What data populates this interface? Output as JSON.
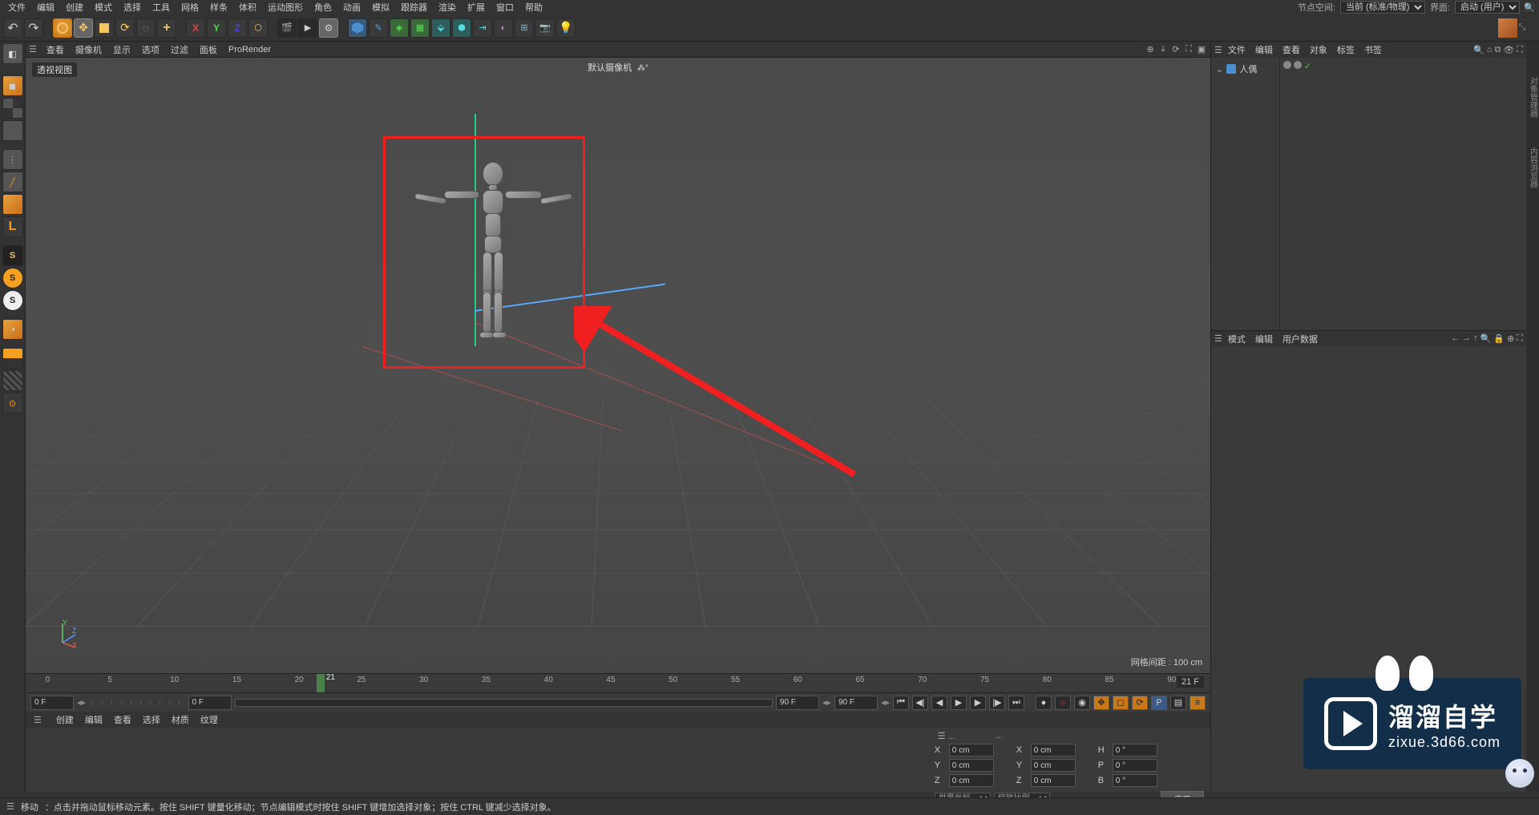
{
  "menubar": {
    "items": [
      "文件",
      "编辑",
      "创建",
      "模式",
      "选择",
      "工具",
      "网格",
      "样条",
      "体积",
      "运动图形",
      "角色",
      "动画",
      "模拟",
      "跟踪器",
      "渲染",
      "扩展",
      "窗口",
      "帮助"
    ],
    "node_space_label": "节点空间:",
    "node_space_value": "当前 (标准/物理)",
    "interface_label": "界面:",
    "interface_value": "启动 (用户)"
  },
  "view_menu": {
    "items": [
      "查看",
      "摄像机",
      "显示",
      "选项",
      "过滤",
      "面板",
      "ProRender"
    ]
  },
  "viewport": {
    "name": "透视视图",
    "camera": "默认摄像机",
    "grid_info": "网格间距 : 100 cm"
  },
  "nav_axes": {
    "x": "X",
    "y": "Y",
    "z": "Z"
  },
  "timeline": {
    "ticks": [
      "0",
      "5",
      "10",
      "15",
      "20",
      "25",
      "30",
      "35",
      "40",
      "45",
      "50",
      "55",
      "60",
      "65",
      "70",
      "75",
      "80",
      "85",
      "90"
    ],
    "playhead_frame": "21",
    "current_frame_label": "21 F",
    "start": "0 F",
    "preview_start": "0 F",
    "preview_end": "90 F",
    "end": "90 F"
  },
  "material_menu": {
    "items": [
      "创建",
      "编辑",
      "查看",
      "选择",
      "材质",
      "纹理"
    ]
  },
  "coords": {
    "header1": "...",
    "header2": "...",
    "pos": {
      "x": "0 cm",
      "y": "0 cm",
      "z": "0 cm"
    },
    "size": {
      "x": "0 cm",
      "y": "0 cm",
      "z": "0 cm"
    },
    "rot": {
      "h": "0 °",
      "p": "0 °",
      "b": "0 °"
    },
    "space": "世界坐标",
    "scale_mode": "缩放比例",
    "apply": "应用"
  },
  "object_panel": {
    "menu": [
      "文件",
      "编辑",
      "查看",
      "对象",
      "标签",
      "书签"
    ],
    "item": {
      "icon": "mannequin",
      "name": "人偶"
    }
  },
  "attribute_panel": {
    "menu": [
      "模式",
      "编辑",
      "用户数据"
    ]
  },
  "right_tabs": [
    "对象管理器",
    "内容浏览器"
  ],
  "watermark": {
    "title": "溜溜自学",
    "url": "zixue.3d66.com"
  },
  "statusbar": {
    "tool": "移动",
    "hint": "：点击并拖动鼠标移动元素。按住 SHIFT 键量化移动；节点编辑模式时按住 SHIFT 键增加选择对象；按住 CTRL 键减少选择对象。"
  },
  "labels": {
    "X": "X",
    "Y": "Y",
    "Z": "Z",
    "H": "H",
    "P": "P",
    "B": "B"
  }
}
